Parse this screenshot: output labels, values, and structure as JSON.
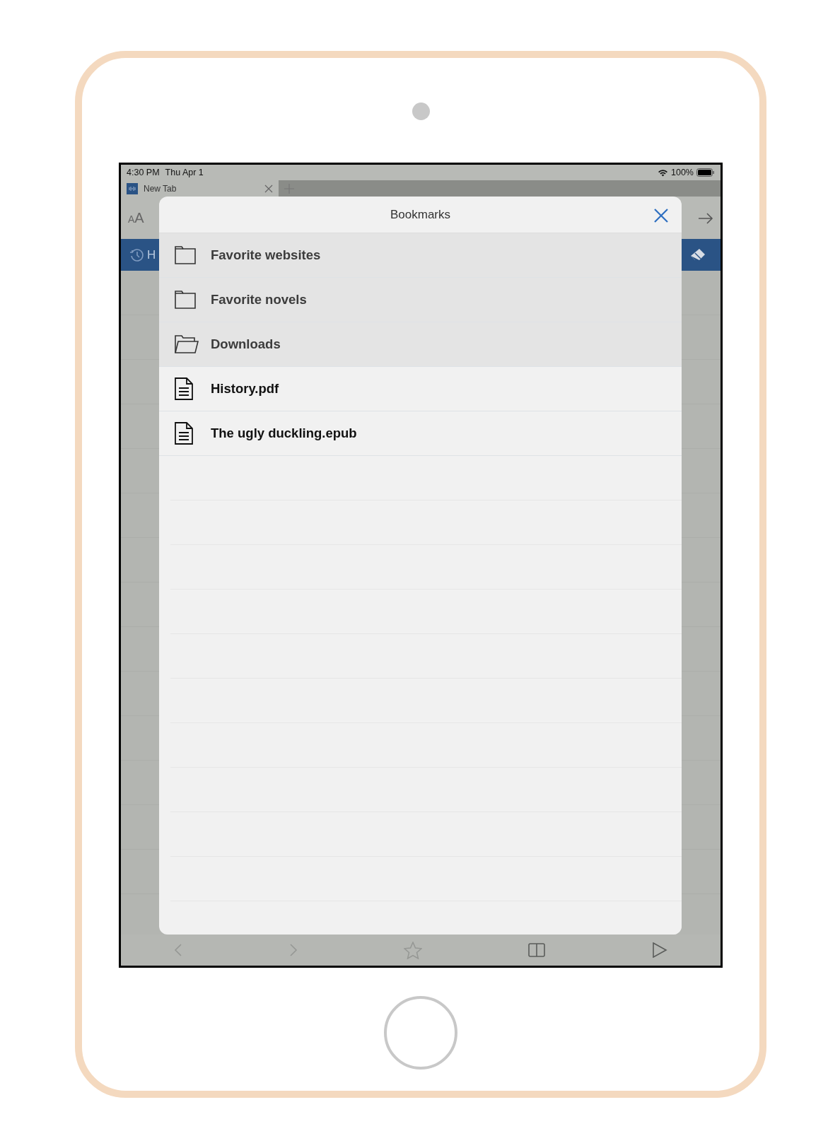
{
  "status_bar": {
    "time": "4:30 PM",
    "date": "Thu Apr 1",
    "battery": "100%"
  },
  "tabs": [
    {
      "label": "New Tab",
      "selected": true
    }
  ],
  "toolbar": {
    "text_size": "AA"
  },
  "history_bar": {
    "label": "H"
  },
  "bookmarks": {
    "title": "Bookmarks",
    "items": [
      {
        "kind": "folder",
        "label": "Favorite websites"
      },
      {
        "kind": "folder",
        "label": "Favorite novels"
      },
      {
        "kind": "open-folder",
        "label": "Downloads"
      },
      {
        "kind": "file",
        "label": "History.pdf"
      },
      {
        "kind": "file",
        "label": "The ugly duckling.epub"
      }
    ]
  },
  "bottom_toolbar": [
    {
      "kind": "back",
      "disabled": true
    },
    {
      "kind": "forward",
      "disabled": true
    },
    {
      "kind": "star",
      "disabled": true
    },
    {
      "kind": "book",
      "disabled": false
    },
    {
      "kind": "play",
      "disabled": false
    }
  ]
}
